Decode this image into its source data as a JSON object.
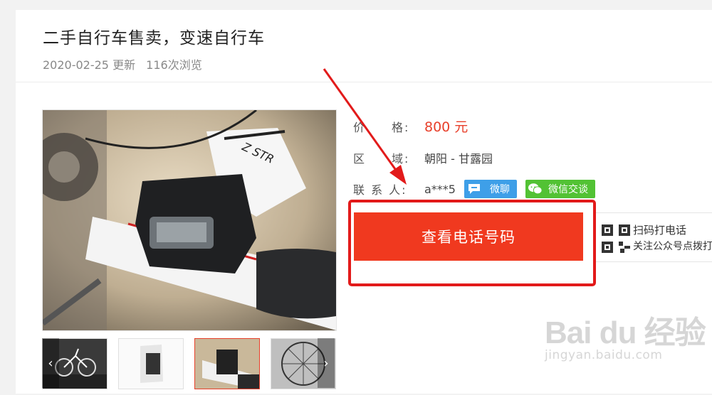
{
  "listing": {
    "title": "二手自行车售卖，变速自行车",
    "updated_date": "2020-02-25 更新",
    "views": "116次浏览"
  },
  "details": {
    "price_label": "价　　格:",
    "price_value": "800 元",
    "area_label": "区　　域:",
    "area_value": "朝阳 - 甘露园",
    "contact_label": "联 系 人:",
    "contact_value": "a***5",
    "chat_label": "微聊",
    "wechat_label": "微信交谈"
  },
  "actions": {
    "view_phone_label": "查看电话号码",
    "qr_title": "扫码打电话",
    "qr_desc": "关注公众号点拨打"
  },
  "gallery": {
    "thumb_count": 4,
    "active_thumb": 3
  },
  "watermark": {
    "logo": "Bai du 经验",
    "url": "jingyan.baidu.com"
  },
  "colors": {
    "accent_red": "#f0391f",
    "chat_blue": "#3e9fe8",
    "wechat_green": "#52c234",
    "annotation_red": "#e21a1a"
  }
}
